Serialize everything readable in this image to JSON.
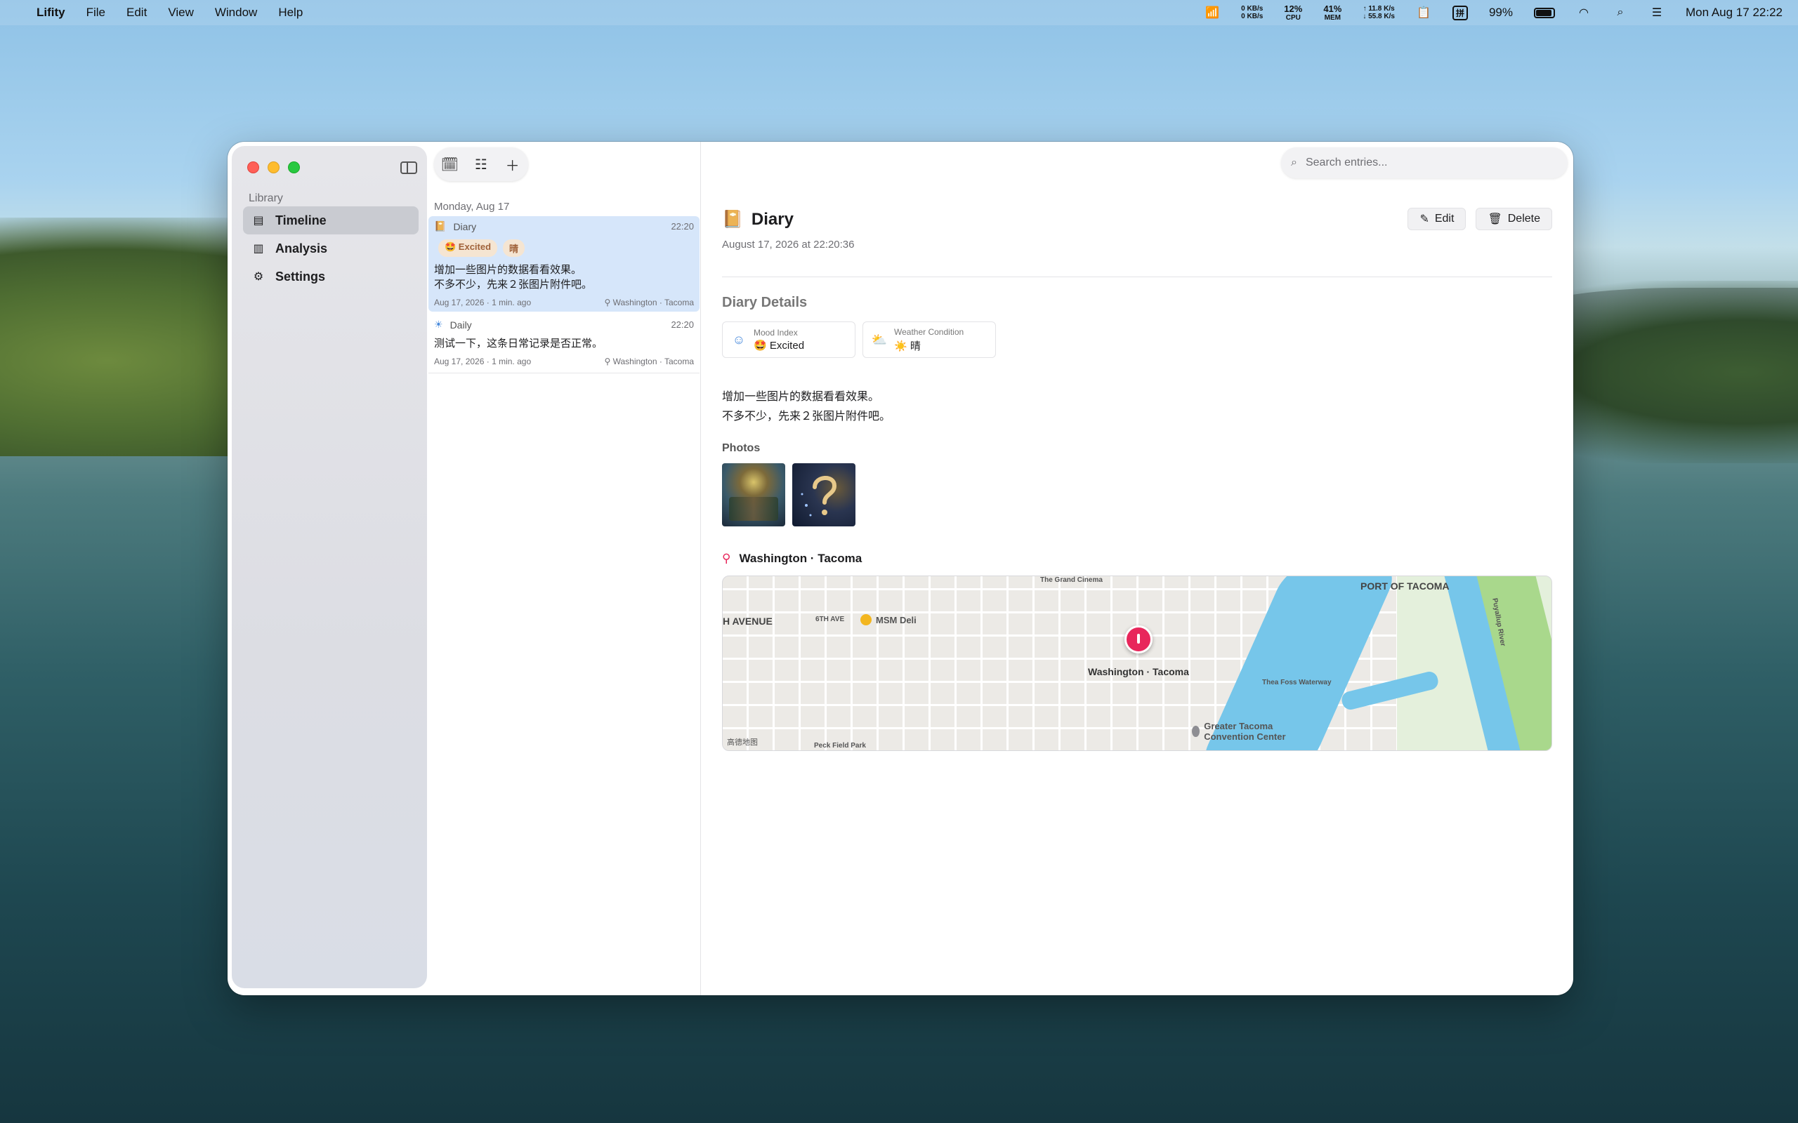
{
  "menubar": {
    "app_name": "Lifity",
    "menus": [
      "File",
      "Edit",
      "View",
      "Window",
      "Help"
    ],
    "net_up": "0 KB/s",
    "net_down": "0 KB/s",
    "cpu_value": "12%",
    "cpu_label": "CPU",
    "mem_value": "41%",
    "mem_label": "MEM",
    "traffic_up": "↑ 11.8 K/s",
    "traffic_down": "↓ 55.8 K/s",
    "ime": "拼",
    "battery": "99%",
    "clock": "Mon Aug 17  22:22"
  },
  "sidebar": {
    "section": "Library",
    "items": [
      {
        "label": "Timeline",
        "icon": "calendar-icon",
        "active": true
      },
      {
        "label": "Analysis",
        "icon": "chart-icon",
        "active": false
      },
      {
        "label": "Settings",
        "icon": "gear-icon",
        "active": false
      }
    ]
  },
  "list": {
    "day_header": "Monday, Aug 17",
    "entries": [
      {
        "type": "Diary",
        "time": "22:20",
        "tags": [
          "🤩 Excited",
          "晴"
        ],
        "text_line1": "增加一些图片的数据看看效果。",
        "text_line2": "不多不少，先来２张图片附件吧。",
        "date": "Aug 17, 2026",
        "ago": "· 1 min. ago",
        "location": "Washington · Tacoma"
      },
      {
        "type": "Daily",
        "time": "22:20",
        "text_line1": "测试一下，这条日常记录是否正常。",
        "date": "Aug 17, 2026",
        "ago": "· 1 min. ago",
        "location": "Washington · Tacoma"
      }
    ]
  },
  "detail": {
    "search_placeholder": "Search entries...",
    "title": "Diary",
    "datetime": "August 17, 2026 at 22:20:36",
    "edit_label": "Edit",
    "delete_label": "Delete",
    "details_heading": "Diary Details",
    "cards": [
      {
        "label": "Mood Index",
        "value": "🤩 Excited"
      },
      {
        "label": "Weather Condition",
        "value": "☀️ 晴"
      }
    ],
    "body_line1": "增加一些图片的数据看看效果。",
    "body_line2": "不多不少，先来２张图片附件吧。",
    "photos_heading": "Photos",
    "location_heading": "Washington · Tacoma",
    "map": {
      "pin_label": "Washington · Tacoma",
      "poi_deli": "MSM Deli",
      "poi_convention": "Greater Tacoma Convention Center",
      "label_port": "PORT OF TACOMA",
      "label_avenue": "H AVENUE",
      "label_sixth": "6TH AVE",
      "label_peck": "Peck Field Park",
      "label_cinema": "The Grand Cinema",
      "label_foss": "Thea Foss Waterway",
      "label_puyallup": "Puyallup River",
      "attribution": "高德地图"
    }
  }
}
